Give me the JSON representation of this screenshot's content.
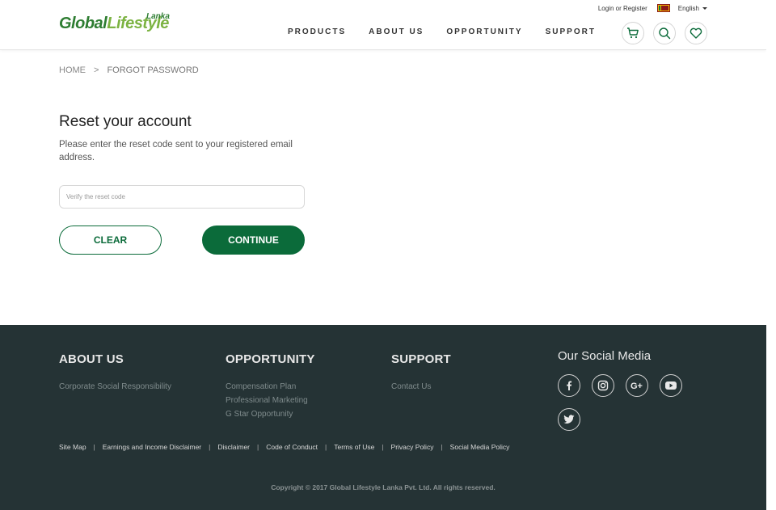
{
  "header": {
    "logo_main": "Global",
    "logo_accent": "Lifestyle",
    "logo_sub": "Lanka",
    "login_text": "Login or Register",
    "language": "English",
    "nav": [
      "PRODUCTS",
      "ABOUT US",
      "OPPORTUNITY",
      "SUPPORT"
    ]
  },
  "breadcrumb": {
    "home": "HOME",
    "separator": ">",
    "current": "FORGOT PASSWORD"
  },
  "main": {
    "title": "Reset your account",
    "description": "Please enter the reset code sent to your registered email address.",
    "input_placeholder": "Verify the reset code",
    "input_value": "",
    "clear_label": "CLEAR",
    "continue_label": "CONTINUE"
  },
  "footer": {
    "about": {
      "heading": "ABOUT US",
      "links": [
        "Corporate Social Responsibility"
      ]
    },
    "opportunity": {
      "heading": "OPPORTUNITY",
      "links": [
        "Compensation Plan",
        "Professional Marketing",
        "G Star Opportunity"
      ]
    },
    "support": {
      "heading": "SUPPORT",
      "links": [
        "Contact Us"
      ]
    },
    "social_heading": "Our Social Media",
    "social_icons": [
      "facebook-icon",
      "instagram-icon",
      "google-plus-icon",
      "youtube-icon",
      "twitter-icon"
    ],
    "legal_links": [
      "Site Map",
      "Earnings and Income Disclaimer",
      "Disclaimer",
      "Code of Conduct",
      "Terms of Use",
      "Privacy Policy",
      "Social Media Policy"
    ],
    "legal_separator": "|",
    "copyright": "Copyright © 2017 Global Lifestyle Lanka Pvt. Ltd. All rights reserved."
  },
  "colors": {
    "brand_green": "#0b6b3a",
    "logo_green": "#2e7d32",
    "logo_light_green": "#7cb342",
    "footer_bg": "#253335"
  }
}
